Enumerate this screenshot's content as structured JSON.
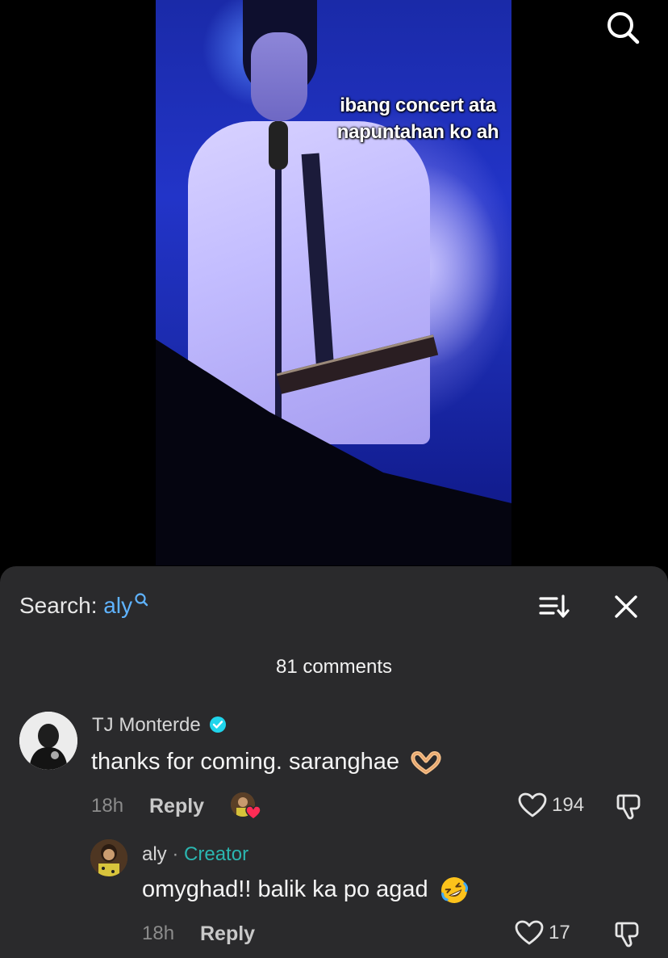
{
  "video": {
    "caption_line1": "ibang concert ata",
    "caption_line2": "napuntahan ko ah",
    "search_icon": "search-icon"
  },
  "sheet": {
    "search_prefix": "Search:",
    "search_term": "aly",
    "comment_count": "81 comments",
    "sort_icon": "sort-icon",
    "close_icon": "close-icon"
  },
  "comments": [
    {
      "username": "TJ Monterde",
      "verified": true,
      "text": "thanks for coming. saranghae",
      "emoji": "heart-hands-emoji",
      "time": "18h",
      "reply_label": "Reply",
      "likes": "194",
      "liked_by_creator": true
    }
  ],
  "replies": [
    {
      "username": "aly",
      "separator": "·",
      "badge": "Creator",
      "text": "omyghad!! balik ka po agad",
      "emoji": "rolling-laughing-emoji",
      "time": "18h",
      "reply_label": "Reply",
      "likes": "17"
    }
  ],
  "colors": {
    "sheet_bg": "#2a2a2c",
    "search_term": "#5fb3ff",
    "creator_badge": "#2bb6b0",
    "verified": "#20d5ec"
  }
}
